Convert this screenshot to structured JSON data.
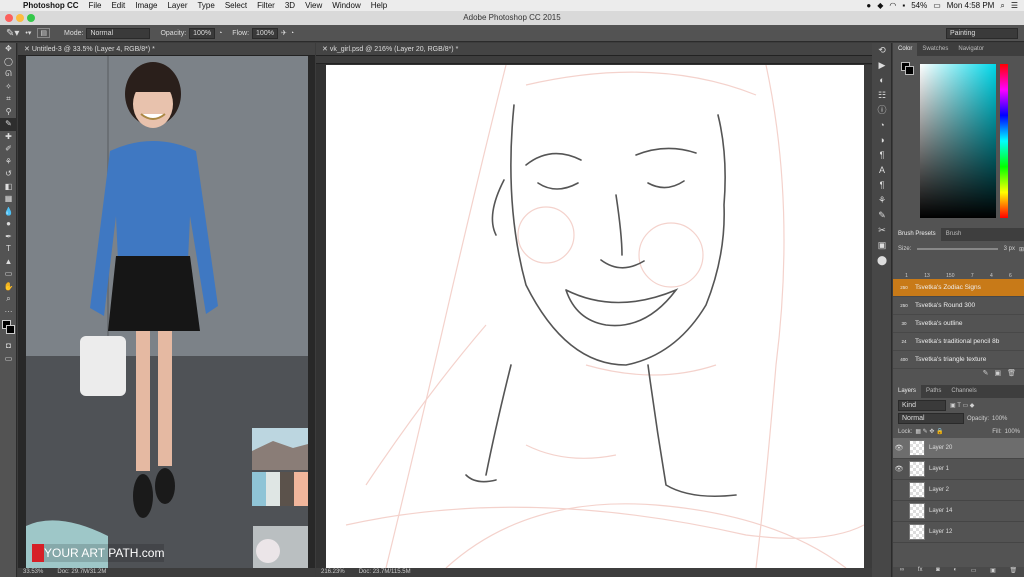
{
  "menubar": {
    "items": [
      "Photoshop CC",
      "File",
      "Edit",
      "Image",
      "Layer",
      "Type",
      "Select",
      "Filter",
      "3D",
      "View",
      "Window",
      "Help"
    ],
    "battery": "54%",
    "clock": "Mon 4:58 PM"
  },
  "titlebar": {
    "title": "Adobe Photoshop CC 2015"
  },
  "options": {
    "mode_label": "Mode:",
    "mode_value": "Normal",
    "opacity_label": "Opacity:",
    "opacity_value": "100%",
    "flow_label": "Flow:",
    "flow_value": "100%",
    "workspace": "Painting"
  },
  "doc_left": {
    "tab": "Untitled-3 @ 33.5% (Layer 4, RGB/8*) *",
    "zoom": "33.53%",
    "docsize": "Doc: 29.7M/31.2M",
    "watermark": "YOUR ART PATH.com",
    "watermark_accent": "#d62027",
    "swatches": [
      "#8fc4d6",
      "#dfe6e4",
      "#5b524b",
      "#f1b69c"
    ]
  },
  "doc_right": {
    "tab": "vk_girl.psd @ 216% (Layer 20, RGB/8*) *",
    "zoom": "216.23%",
    "docsize": "Doc: 23.7M/115.5M"
  },
  "color_panel": {
    "tabs": [
      "Color",
      "Swatches",
      "Navigator"
    ]
  },
  "brush_panel": {
    "tabs": [
      "Brush Presets",
      "Brush"
    ],
    "size_label": "Size:",
    "size_value": "3 px",
    "tip_sizes": [
      "1",
      "13",
      "150",
      "7",
      "4",
      "6"
    ],
    "presets": [
      {
        "size": "250",
        "name": "Tsvetka's Zodiac Signs",
        "selected": true
      },
      {
        "size": "250",
        "name": "Tsvetka's Round 300"
      },
      {
        "size": "30",
        "name": "Tsvetka's outline"
      },
      {
        "size": "24",
        "name": "Tsvetka's traditional pencil 8b"
      },
      {
        "size": "400",
        "name": "Tsvetka's triangle texture"
      }
    ]
  },
  "layers_panel": {
    "tabs": [
      "Layers",
      "Paths",
      "Channels"
    ],
    "kind": "Kind",
    "blend": "Normal",
    "opacity_label": "Opacity:",
    "opacity_value": "100%",
    "lock_label": "Lock:",
    "fill_label": "Fill:",
    "fill_value": "100%",
    "layers": [
      {
        "name": "Layer 20",
        "visible": true,
        "selected": true
      },
      {
        "name": "Layer 1",
        "visible": true
      },
      {
        "name": "Layer 2",
        "visible": false
      },
      {
        "name": "Layer 14",
        "visible": false
      },
      {
        "name": "Layer 12",
        "visible": false
      }
    ]
  }
}
